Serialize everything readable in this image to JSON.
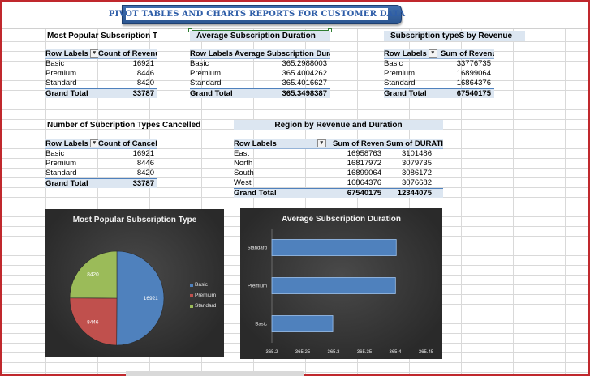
{
  "banner": {
    "title": "PIVOT TABLES AND CHARTS REPORTS FOR CUSTOMER DATA"
  },
  "colors": {
    "accent": "#4f81bd",
    "pivot_header": "#dce6f1",
    "chart_bg": "#3a3a3a",
    "border": "#c0282d"
  },
  "pivot_popular": {
    "title": "Most Popular Subscription Type",
    "headers": [
      "Row Labels",
      "Count of Revenue"
    ],
    "rows": [
      [
        "Basic",
        "16921"
      ],
      [
        "Premium",
        "8446"
      ],
      [
        "Standard",
        "8420"
      ]
    ],
    "total": [
      "Grand Total",
      "33787"
    ]
  },
  "pivot_duration": {
    "title": "Average Subscription Duration",
    "headers": [
      "Row Labels",
      "Average Subscription Duration"
    ],
    "rows": [
      [
        "Basic",
        "365.2988003"
      ],
      [
        "Premium",
        "365.4004262"
      ],
      [
        "Standard",
        "365.4016627"
      ]
    ],
    "total": [
      "Grand Total",
      "365.3498387"
    ]
  },
  "pivot_revenue": {
    "title": "Subscription typeS by Revenue",
    "headers": [
      "Row Labels",
      "Sum of Revenue"
    ],
    "rows": [
      [
        "Basic",
        "33776735"
      ],
      [
        "Premium",
        "16899064"
      ],
      [
        "Standard",
        "16864376"
      ]
    ],
    "total": [
      "Grand Total",
      "67540175"
    ]
  },
  "pivot_cancelled": {
    "title": "Number of Subcription Types Cancelled",
    "headers": [
      "Row Labels",
      "Count of Canceled"
    ],
    "rows": [
      [
        "Basic",
        "16921"
      ],
      [
        "Premium",
        "8446"
      ],
      [
        "Standard",
        "8420"
      ]
    ],
    "total": [
      "Grand Total",
      "33787"
    ]
  },
  "pivot_region": {
    "title": "Region by Revenue and Duration",
    "headers": [
      "Row Labels",
      "Sum of Revenue",
      "Sum of DURATION"
    ],
    "rows": [
      [
        "East",
        "16958763",
        "3101486"
      ],
      [
        "North",
        "16817972",
        "3079735"
      ],
      [
        "South",
        "16899064",
        "3086172"
      ],
      [
        "West",
        "16864376",
        "3076682"
      ]
    ],
    "total": [
      "Grand Total",
      "67540175",
      "12344075"
    ]
  },
  "chart_data": [
    {
      "type": "pie",
      "title": "Most Popular Subscription Type",
      "categories": [
        "Basic",
        "Premium",
        "Standard"
      ],
      "values": [
        16921,
        8446,
        8420
      ],
      "colors": [
        "#4f81bd",
        "#c0504d",
        "#9bbb59"
      ],
      "legend": "right"
    },
    {
      "type": "bar",
      "orientation": "horizontal",
      "title": "Average Subscription Duration",
      "categories": [
        "Basic",
        "Premium",
        "Standard"
      ],
      "values": [
        365.2988003,
        365.4004262,
        365.4016627
      ],
      "xlim": [
        365.2,
        365.45
      ],
      "xticks": [
        "365.2",
        "365.25",
        "365.3",
        "365.35",
        "365.4",
        "365.45"
      ],
      "color": "#4f81bd"
    }
  ]
}
